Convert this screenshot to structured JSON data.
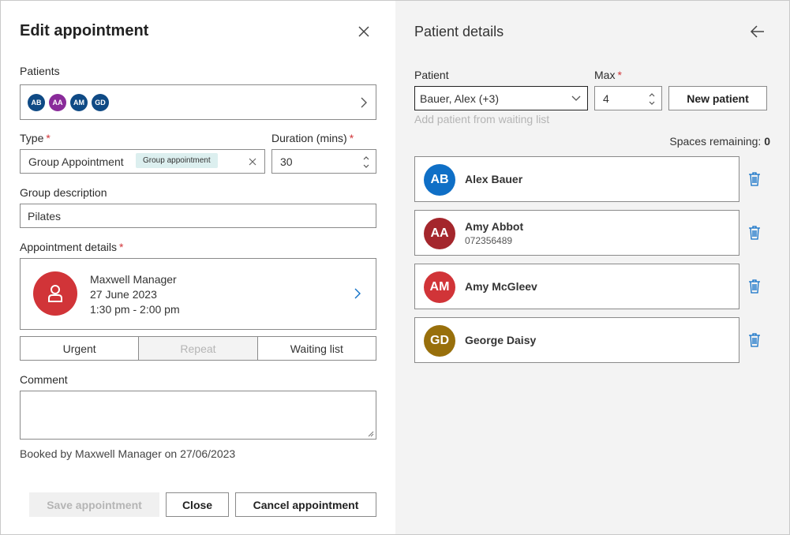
{
  "edit": {
    "title": "Edit appointment",
    "patients_label": "Patients",
    "patient_initials": [
      "AB",
      "AA",
      "AM",
      "GD"
    ],
    "type_label": "Type",
    "type_value": "Group Appointment",
    "type_chip": "Group appointment",
    "duration_label": "Duration (mins)",
    "duration_value": "30",
    "group_desc_label": "Group description",
    "group_desc_value": "Pilates",
    "appt_details_label": "Appointment details",
    "appt_clinician": "Maxwell Manager",
    "appt_date": "27 June 2023",
    "appt_time": "1:30 pm - 2:00 pm",
    "toggles": [
      "Urgent",
      "Repeat",
      "Waiting list"
    ],
    "comment_label": "Comment",
    "comment_value": "",
    "booked_by": "Booked by Maxwell Manager on 27/06/2023",
    "save_label": "Save appointment",
    "close_label": "Close",
    "cancel_label": "Cancel appointment",
    "required_mark": "*"
  },
  "details": {
    "title": "Patient details",
    "patient_label": "Patient",
    "patient_value": "Bauer, Alex (+3)",
    "max_label": "Max",
    "max_value": "4",
    "new_patient_label": "New patient",
    "waiting_link": "Add patient from waiting list",
    "spaces_label": "Spaces remaining:",
    "spaces_value": "0",
    "patients": [
      {
        "initials": "AB",
        "name": "Alex Bauer",
        "sub": ""
      },
      {
        "initials": "AA",
        "name": "Amy Abbot",
        "sub": "072356489"
      },
      {
        "initials": "AM",
        "name": "Amy McGleev",
        "sub": ""
      },
      {
        "initials": "GD",
        "name": "George Daisy",
        "sub": ""
      }
    ]
  },
  "colors": {
    "ab": "#0f6fc6",
    "aa": "#a4262c",
    "am": "#d13438",
    "gd": "#986f0b",
    "ab_small": "#0f4a85",
    "aa_small": "#8a2b9a",
    "am_small": "#0f4a85",
    "gd_small": "#0f4a85",
    "accent": "#0f6fc6",
    "required": "#d13438"
  }
}
